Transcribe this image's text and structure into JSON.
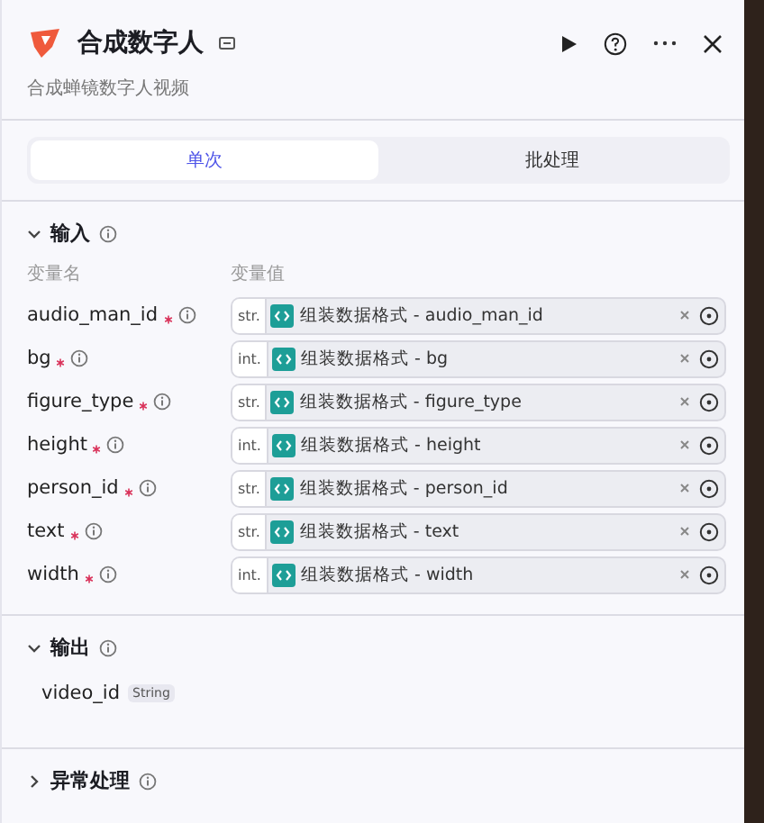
{
  "header": {
    "title": "合成数字人",
    "description": "合成蝉镜数字人视频"
  },
  "tabs": [
    {
      "label": "单次",
      "selected": true
    },
    {
      "label": "批处理",
      "selected": false
    }
  ],
  "input_section": {
    "title": "输入",
    "expanded": true,
    "columns": [
      "变量名",
      "变量值"
    ],
    "rows": [
      {
        "name": "audio_man_id",
        "required": true,
        "type": "str.",
        "value": "组装数据格式 - audio_man_id"
      },
      {
        "name": "bg",
        "required": true,
        "type": "int.",
        "value": "组装数据格式 - bg"
      },
      {
        "name": "figure_type",
        "required": true,
        "type": "str.",
        "value": "组装数据格式 - figure_type"
      },
      {
        "name": "height",
        "required": true,
        "type": "int.",
        "value": "组装数据格式 - height"
      },
      {
        "name": "person_id",
        "required": true,
        "type": "str.",
        "value": "组装数据格式 - person_id"
      },
      {
        "name": "text",
        "required": true,
        "type": "str.",
        "value": "组装数据格式 - text"
      },
      {
        "name": "width",
        "required": true,
        "type": "int.",
        "value": "组装数据格式 - width"
      }
    ]
  },
  "output_section": {
    "title": "输出",
    "expanded": true,
    "outputs": [
      {
        "name": "video_id",
        "type": "String"
      }
    ]
  },
  "error_section": {
    "title": "异常处理",
    "expanded": false
  }
}
